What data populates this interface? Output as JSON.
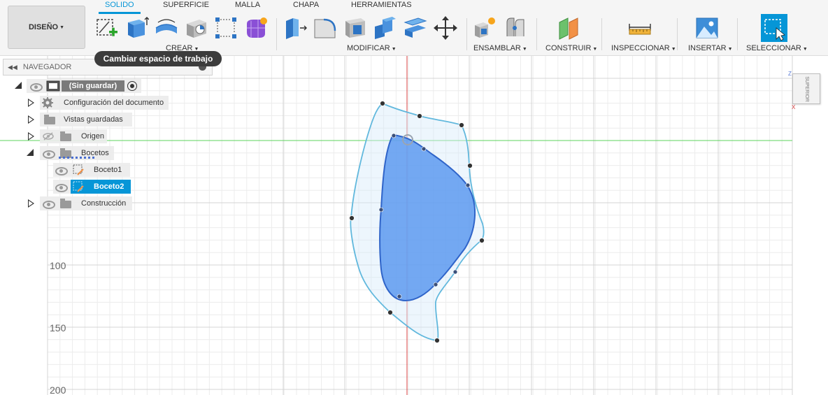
{
  "workspace": {
    "label": "DISEÑO"
  },
  "tabs": [
    {
      "label": "SOLIDO",
      "active": true
    },
    {
      "label": "SUPERFICIE"
    },
    {
      "label": "MALLA"
    },
    {
      "label": "CHAPA"
    },
    {
      "label": "HERRAMIENTAS"
    }
  ],
  "groups": {
    "crear": "CREAR",
    "modificar": "MODIFICAR",
    "ensamblar": "ENSAMBLAR",
    "construir": "CONSTRUIR",
    "inspeccionar": "INSPECCIONAR",
    "insertar": "INSERTAR",
    "seleccionar": "SELECCIONAR"
  },
  "tooltip": "Cambiar espacio de trabajo",
  "navigator": {
    "title": "NAVEGADOR",
    "root": "(Sin guardar)",
    "items": {
      "config": "Configuración del documento",
      "views": "Vistas guardadas",
      "origin": "Origen",
      "sketches": "Bocetos",
      "sketch1": "Boceto1",
      "sketch2": "Boceto2",
      "construction": "Construcción"
    }
  },
  "viewport": {
    "axis_labels": [
      "100",
      "150",
      "200"
    ],
    "viewcube_face": "SUPERIOR",
    "triad": {
      "z": "Z",
      "x": "X"
    }
  },
  "colors": {
    "accent": "#0696d7",
    "profile_fill": "#5d9af0",
    "profile_stroke": "#2f64c9",
    "spline": "#61b8dd",
    "x_axis": "#d94040",
    "y_axis": "#5cd35c"
  },
  "icons": [
    "new-sketch-icon",
    "extrude-icon",
    "revolve-icon",
    "hole-icon",
    "pattern-icon",
    "create-form-icon",
    "press-pull-icon",
    "fillet-icon",
    "shell-icon",
    "combine-icon",
    "offset-face-icon",
    "move-icon",
    "new-component-icon",
    "joint-icon",
    "plane-icon",
    "measure-icon",
    "insert-image-icon",
    "select-icon",
    "eye-icon",
    "folder-icon",
    "gear-icon"
  ]
}
